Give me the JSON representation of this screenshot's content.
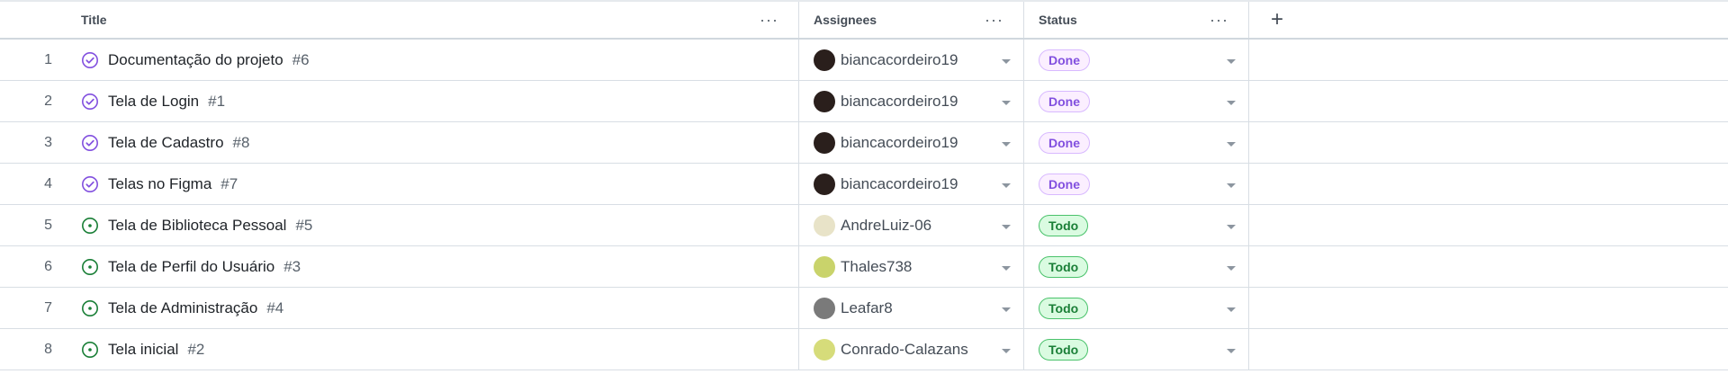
{
  "headers": {
    "title": "Title",
    "assignees": "Assignees",
    "status": "Status",
    "more_symbol": "···",
    "add_symbol": "+"
  },
  "rows": [
    {
      "num": "1",
      "title": "Documentação do projeto",
      "issue": "#6",
      "state": "closed",
      "assignee": "biancacordeiro19",
      "status": "Done"
    },
    {
      "num": "2",
      "title": "Tela de Login",
      "issue": "#1",
      "state": "closed",
      "assignee": "biancacordeiro19",
      "status": "Done"
    },
    {
      "num": "3",
      "title": "Tela de Cadastro",
      "issue": "#8",
      "state": "closed",
      "assignee": "biancacordeiro19",
      "status": "Done"
    },
    {
      "num": "4",
      "title": "Telas no Figma",
      "issue": "#7",
      "state": "closed",
      "assignee": "biancacordeiro19",
      "status": "Done"
    },
    {
      "num": "5",
      "title": "Tela de Biblioteca Pessoal",
      "issue": "#5",
      "state": "open",
      "assignee": "AndreLuiz-06",
      "status": "Todo"
    },
    {
      "num": "6",
      "title": "Tela de Perfil do Usuário",
      "issue": "#3",
      "state": "open",
      "assignee": "Thales738",
      "status": "Todo"
    },
    {
      "num": "7",
      "title": "Tela de Administração",
      "issue": "#4",
      "state": "open",
      "assignee": "Leafar8",
      "status": "Todo"
    },
    {
      "num": "8",
      "title": "Tela inicial",
      "issue": "#2",
      "state": "open",
      "assignee": "Conrado-Calazans",
      "status": "Todo"
    }
  ],
  "colors": {
    "closed_icon": "#8250df",
    "open_icon": "#1a7f37",
    "avatar_bianca": "#2a1f1c",
    "avatar_andre": "#e8e3c8",
    "avatar_thales": "#c9d36b",
    "avatar_leafar": "#7a7a7a",
    "avatar_conrado": "#d6dc7a"
  }
}
